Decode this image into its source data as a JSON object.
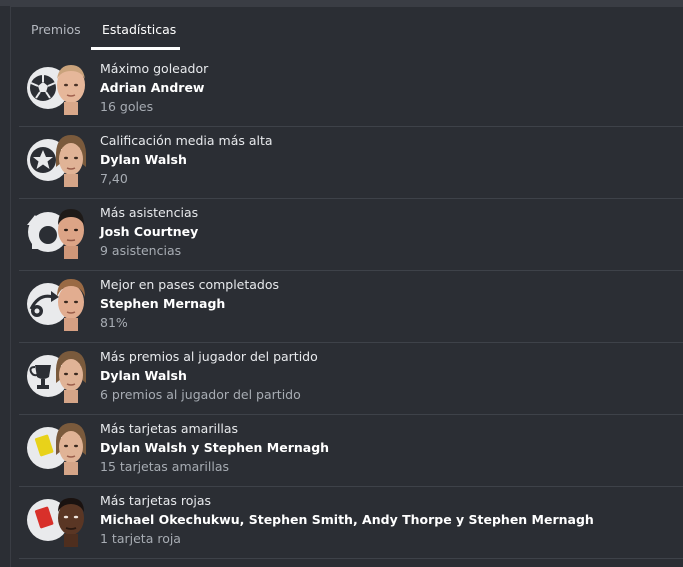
{
  "tabs": [
    {
      "label": "Premios",
      "active": false
    },
    {
      "label": "Estadísticas",
      "active": true
    }
  ],
  "stats": [
    {
      "category": "Máximo goleador",
      "players": "Adrian Andrew",
      "value": "16 goles",
      "icon": "football-icon"
    },
    {
      "category": "Calificación media más alta",
      "players": "Dylan Walsh",
      "value": "7,40",
      "icon": "star-icon"
    },
    {
      "category": "Más asistencias",
      "players": "Josh Courtney",
      "value": "9 asistencias",
      "icon": "assist-arrow-icon"
    },
    {
      "category": "Mejor en pases completados",
      "players": "Stephen Mernagh",
      "value": "81%",
      "icon": "pass-icon"
    },
    {
      "category": "Más premios al jugador del partido",
      "players": "Dylan Walsh",
      "value": "6 premios al jugador del partido",
      "icon": "trophy-icon"
    },
    {
      "category": "Más tarjetas amarillas",
      "players": "Dylan Walsh y Stephen Mernagh",
      "value": "15 tarjetas amarillas",
      "icon": "yellow-card-icon"
    },
    {
      "category": "Más tarjetas rojas",
      "players": "Michael Okechukwu, Stephen Smith, Andy Thorpe y Stephen Mernagh",
      "value": "1 tarjeta roja",
      "icon": "red-card-icon"
    }
  ],
  "colors": {
    "background": "#2b2e34",
    "divider": "#3e4249",
    "yellow_card": "#e8d21a",
    "red_card": "#d8302a"
  }
}
